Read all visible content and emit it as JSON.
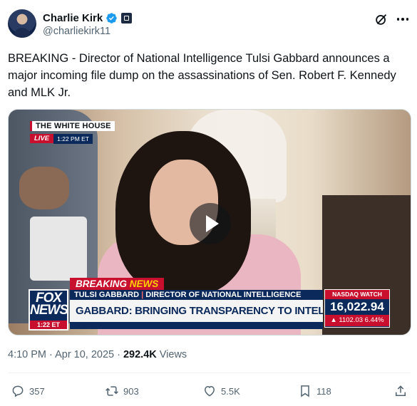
{
  "author": {
    "name": "Charlie Kirk",
    "handle": "@charliekirk11"
  },
  "tweet": {
    "text": "BREAKING - Director of National Intelligence Tulsi Gabbard announces a major incoming file dump on the assassinations of Sen. Robert F. Kennedy and MLK Jr."
  },
  "media": {
    "location_bug": "THE WHITE HOUSE",
    "live_label": "LIVE",
    "live_time": "1:22 PM ET",
    "network_logo": "FOX NEWS",
    "network_time": "1:22 ET",
    "breaking_label": "BREAKING",
    "breaking_news_word": "NEWS",
    "lower_third_name": "TULSI GABBARD",
    "lower_third_title": "DIRECTOR OF NATIONAL INTELLIGENCE",
    "headline": "GABBARD: BRINGING TRANSPARENCY TO INTEL COMMUNITY",
    "ticker_label": "NASDAQ WATCH",
    "ticker_value": "16,022.94",
    "ticker_change": "▲ 1102.03 6.44%"
  },
  "meta": {
    "time": "4:10 PM · Apr 10, 2025 ·",
    "views_count": "292.4K",
    "views_label": "Views"
  },
  "actions": {
    "replies": "357",
    "reposts": "903",
    "likes": "5.5K",
    "bookmarks": "118"
  },
  "icons": {
    "verified": "verified-badge-icon",
    "affiliation": "affiliation-badge-icon",
    "grok": "grok-icon",
    "more": "more-icon",
    "reply": "reply-icon",
    "retweet": "retweet-icon",
    "like": "heart-icon",
    "bookmark": "bookmark-icon",
    "share": "share-icon",
    "play": "play-icon"
  },
  "colors": {
    "text": "#0f1419",
    "muted": "#536471",
    "verified": "#1d9bf0",
    "fox_red": "#c8102e",
    "fox_blue": "#0b2a5b"
  }
}
